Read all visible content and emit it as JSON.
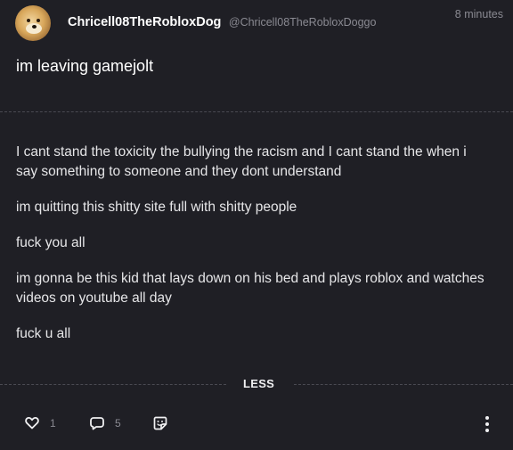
{
  "post": {
    "author": {
      "display_name": "Chricell08TheRobloxDog",
      "handle": "@Chricell08TheRobloxDoggo"
    },
    "timestamp": "8 minutes",
    "title": "im leaving gamejolt",
    "paragraphs": [
      "I cant stand the toxicity the bullying the racism and I cant stand the when i say something to someone and they dont understand",
      "im quitting this shitty site full with shitty people",
      "fuck you all",
      "im gonna be this kid that lays down on his bed and plays roblox and watches videos on youtube all day",
      "fuck u all"
    ],
    "less_label": "LESS"
  },
  "actions": {
    "like_count": "1",
    "comment_count": "5",
    "icons": {
      "like": "heart-icon",
      "comment": "comment-bubble-icon",
      "sticker": "sticker-icon",
      "more": "more-vertical-icon"
    }
  }
}
